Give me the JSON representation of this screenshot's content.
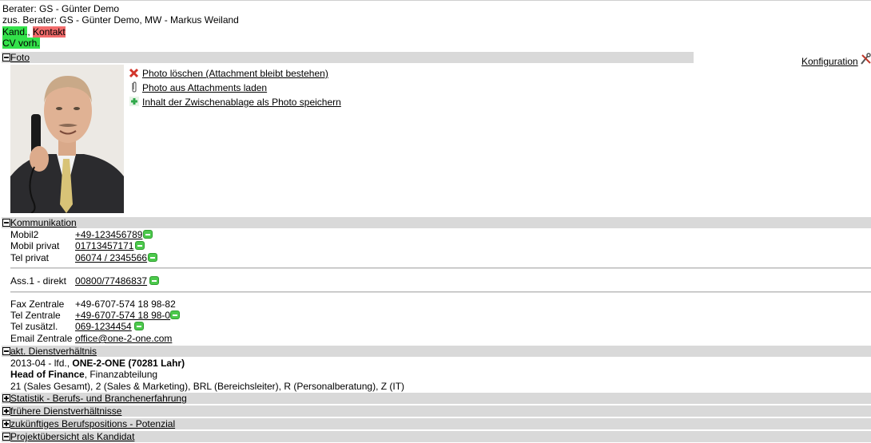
{
  "header": {
    "berater": "Berater: GS - Günter Demo",
    "zus_berater": "zus. Berater: GS - Günter Demo, MW - Markus Weiland",
    "tag_kand": "Kand.",
    "tag_sep": ",",
    "tag_kontakt": "Kontakt",
    "cv_tag": "CV vorh."
  },
  "sections": {
    "foto": "Foto",
    "kommunikation": "Kommunikation",
    "dienstverhaeltnis": "akt. Dienstverhältnis",
    "statistik": "Statistik - Berufs- und Branchenerfahrung",
    "fruehere": "frühere Dienstverhältnisse",
    "zukuenftiges": "zukünftiges Berufspositions - Potenzial",
    "projekte": "Projektübersicht als Kandidat"
  },
  "konfiguration": "Konfiguration",
  "photo_actions": [
    {
      "icon": "delete-x-icon",
      "label": "Photo löschen (Attachment bleibt bestehen)"
    },
    {
      "icon": "paperclip-icon",
      "label": "Photo aus Attachments laden"
    },
    {
      "icon": "green-plus-icon",
      "label": "Inhalt der Zwischenablage als Photo speichern"
    }
  ],
  "kommunikation": {
    "group1": [
      {
        "key": "Mobil2",
        "value": "+49-123456789",
        "link": true,
        "call": true
      },
      {
        "key": "Mobil privat",
        "value": "01713457171",
        "link": true,
        "call": true
      },
      {
        "key": "Tel privat",
        "value": "06074 / 2345566",
        "link": true,
        "call": true
      }
    ],
    "group2": [
      {
        "key": "Ass.1 - direkt",
        "value": "00800/77486837",
        "link": true,
        "call": true
      }
    ],
    "group3": [
      {
        "key": "Fax Zentrale",
        "value": "+49-6707-574 18 98-82",
        "link": false,
        "call": false
      },
      {
        "key": "Tel Zentrale",
        "value": "+49-6707-574 18 98-0",
        "link": true,
        "call": true
      },
      {
        "key": "Tel zusätzl.",
        "value": "069-1234454",
        "link": true,
        "call": true
      },
      {
        "key": "Email Zentrale",
        "value": "office@one-2-one.com",
        "link": true,
        "call": false
      }
    ]
  },
  "dienstverhaeltnis": {
    "date": "2013-04 - lfd., ",
    "company": "ONE-2-ONE (70281 Lahr)",
    "position": "Head of Finance",
    "department": ", Finanzabteilung",
    "codes": "21 (Sales Gesamt), 2 (Sales & Marketing), BRL (Bereichsleiter), R (Personalberatung), Z (IT)"
  },
  "colors": {
    "section_bar": "#d9d9d9",
    "kand_highlight": "#33e24a",
    "kontakt_highlight": "#f26b6b",
    "call_icon": "#4cc94c"
  }
}
